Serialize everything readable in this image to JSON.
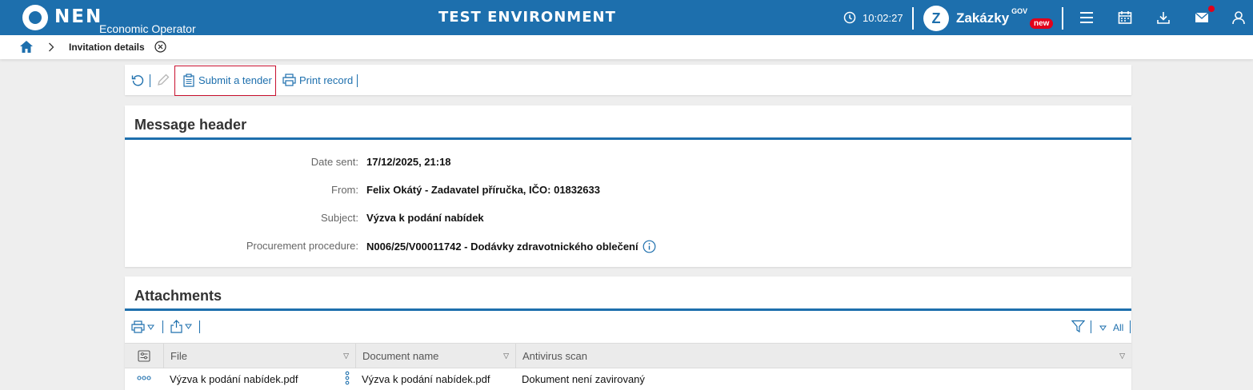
{
  "app": {
    "logo_text": "NEN",
    "logo_subtitle": "Economic Operator",
    "environment_title": "TEST ENVIRONMENT",
    "clock_time": "10:02:27",
    "zakazky_brand": "Zakázky",
    "zakazky_gov": "GOV",
    "zakazky_badge": "new"
  },
  "breadcrumb": {
    "current": "Invitation details"
  },
  "toolbar": {
    "submit_label": "Submit a tender",
    "print_label": "Print record"
  },
  "message_header": {
    "title": "Message header",
    "fields": [
      {
        "label": "Date sent:",
        "value": "17/12/2025, 21:18"
      },
      {
        "label": "From:",
        "value": "Felix Okátý - Zadavatel příručka, IČO: 01832633"
      },
      {
        "label": "Subject:",
        "value": "Výzva k podání nabídek"
      },
      {
        "label": "Procurement procedure:",
        "value": "N006/25/V00011742 - Dodávky zdravotnického oblečení"
      }
    ]
  },
  "attachments": {
    "title": "Attachments",
    "filter_all_label": "All",
    "columns": [
      "File",
      "Document name",
      "Antivirus scan"
    ],
    "rows": [
      {
        "file": "Výzva k podání nabídek.pdf",
        "document_name": "Výzva k podání nabídek.pdf",
        "antivirus": "Dokument není zavirovaný"
      }
    ]
  },
  "colors": {
    "brand_blue": "#1d6fad",
    "alert_red": "#e2001a",
    "highlight_border": "#c8102e"
  }
}
